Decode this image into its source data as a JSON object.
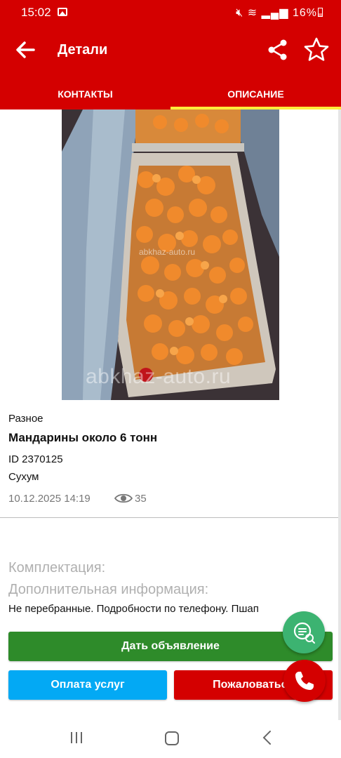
{
  "status_bar": {
    "time": "15:02",
    "battery": "16%"
  },
  "app_bar": {
    "title": "Детали",
    "back_icon": "arrow-back-icon",
    "share_icon": "share-icon",
    "favorite_icon": "star-outline-icon"
  },
  "tabs": [
    {
      "label": "КОНТАКТЫ",
      "active": false
    },
    {
      "label": "ОПИСАНИЕ",
      "active": true
    }
  ],
  "photo": {
    "subject": "mandarins",
    "watermark": "abkhaz-auto.ru",
    "watermark_small": "abkhaz-auto.ru"
  },
  "listing": {
    "category": "Разное",
    "title": "Мандарины около 6 тонн",
    "id": "ID 2370125",
    "city": "Сухум",
    "date": "10.12.2025 14:19",
    "views": "35"
  },
  "details": {
    "equipment_label": "Комплектация:",
    "extra_label": "Дополнительная информация:",
    "extra_text": "Не перебранные. Подробности по телефону. Пшап"
  },
  "buttons": {
    "post_ad": "Дать объявление",
    "pay_services": "Оплата услуг",
    "report": "Пожаловаться"
  },
  "fabs": {
    "chat_icon": "chat-icon",
    "call_icon": "phone-icon"
  },
  "colors": {
    "primary": "#d40000",
    "tab_indicator": "#ffeb3b",
    "post_button": "#2e8b2a",
    "pay_button": "#03a9f4",
    "chat_fab": "#3cb371"
  }
}
